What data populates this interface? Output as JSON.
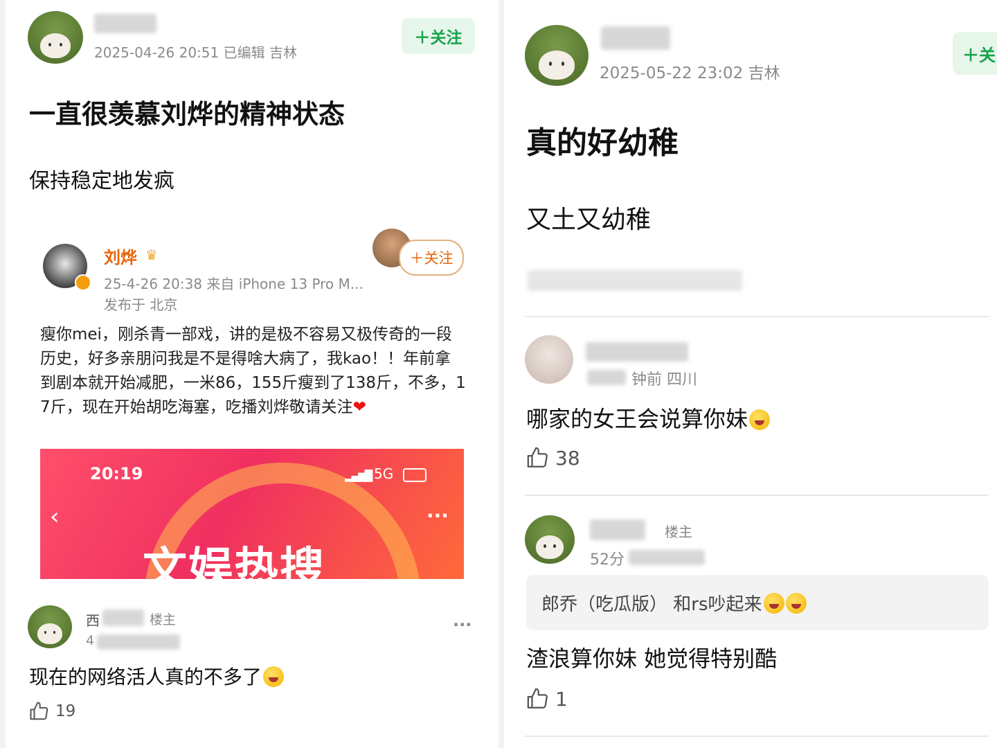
{
  "left": {
    "post": {
      "author_name": "",
      "meta": "2025-04-26 20:51  已编辑  吉林",
      "follow_label": "＋关注",
      "title": "一直很羡慕刘烨的精神状态",
      "subtitle": "保持稳定地发疯"
    },
    "embed": {
      "author": "刘烨",
      "meta_line1": "25-4-26 20:38  来自 iPhone 13 Pro M...",
      "meta_line2": "发布于 北京",
      "follow_label": "＋关注",
      "body": "瘦你mei，刚杀青一部戏，讲的是极不容易又极传奇的一段历史，好多亲朋问我是不是得啥大病了，我kao！！年前拿到剧本就开始减肥，一米86，155斤瘦到了138斤，不多，17斤，现在开始胡吃海塞，吃播刘烨敬请关注",
      "banner": {
        "time": "20:19",
        "network": "5G",
        "title": "文娱热搜"
      }
    },
    "comment": {
      "name": "西",
      "badge": "楼主",
      "time": "4",
      "text": "现在的网络活人真的不多了",
      "likes": "19"
    }
  },
  "right": {
    "post": {
      "meta": "2025-05-22 23:02  吉林",
      "follow_label": "＋关",
      "title": "真的好幼稚",
      "subtitle": "又土又幼稚"
    },
    "comment1": {
      "meta": "钟前  四川",
      "text": "哪家的女王会说算你妹",
      "likes": "38"
    },
    "comment2": {
      "name": "",
      "badge": "楼主",
      "meta": "52分",
      "quote": "郎乔（吃瓜版）  和rs吵起来",
      "text": "渣浪算你妹  她觉得特别酷",
      "likes": "1"
    }
  },
  "colors": {
    "accent_green": "#16a34a",
    "weibo_orange": "#e8650a",
    "banner_red": "#f03060"
  }
}
